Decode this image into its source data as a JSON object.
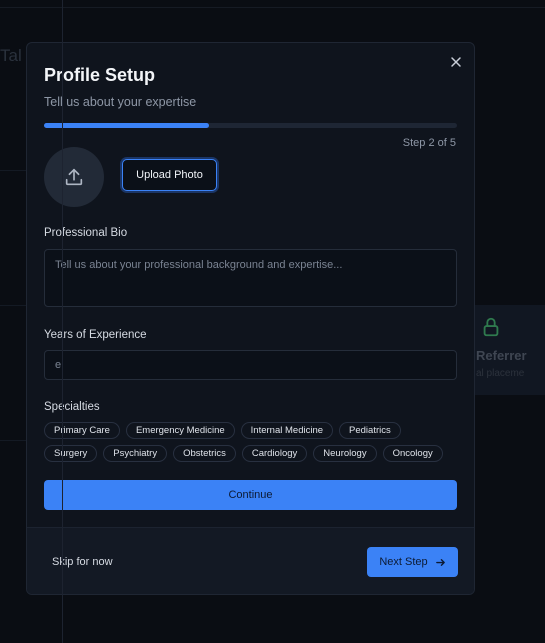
{
  "background": {
    "page_title": "Tal",
    "card_title": "Referrer",
    "card_subtitle": "al placeme"
  },
  "modal": {
    "title": "Profile Setup",
    "subtitle": "Tell us about your expertise",
    "progress": 0.4,
    "step_label": "Step 2 of 5",
    "upload_label": "Upload Photo",
    "bio_label": "Professional Bio",
    "bio_placeholder": "Tell us about your professional background and expertise...",
    "years_label": "Years of Experience",
    "years_placeholder": "e",
    "specialties_label": "Specialties",
    "specialties_row1": [
      "Primary Care",
      "Emergency Medicine",
      "Internal Medicine",
      "Pediatrics"
    ],
    "specialties_row2": [
      "Surgery",
      "Psychiatry",
      "Obstetrics",
      "Cardiology",
      "Neurology",
      "Oncology"
    ],
    "continue_label": "Continue",
    "skip_label": "Skip for now",
    "next_label": "Next Step"
  },
  "colors": {
    "accent": "#3b82f6",
    "modal_bg": "#0f141d",
    "page_bg": "#0a0d13"
  },
  "icons": {
    "close": "close-icon",
    "upload": "upload-icon",
    "next": "arrow-right-icon",
    "lock": "lock-icon"
  }
}
